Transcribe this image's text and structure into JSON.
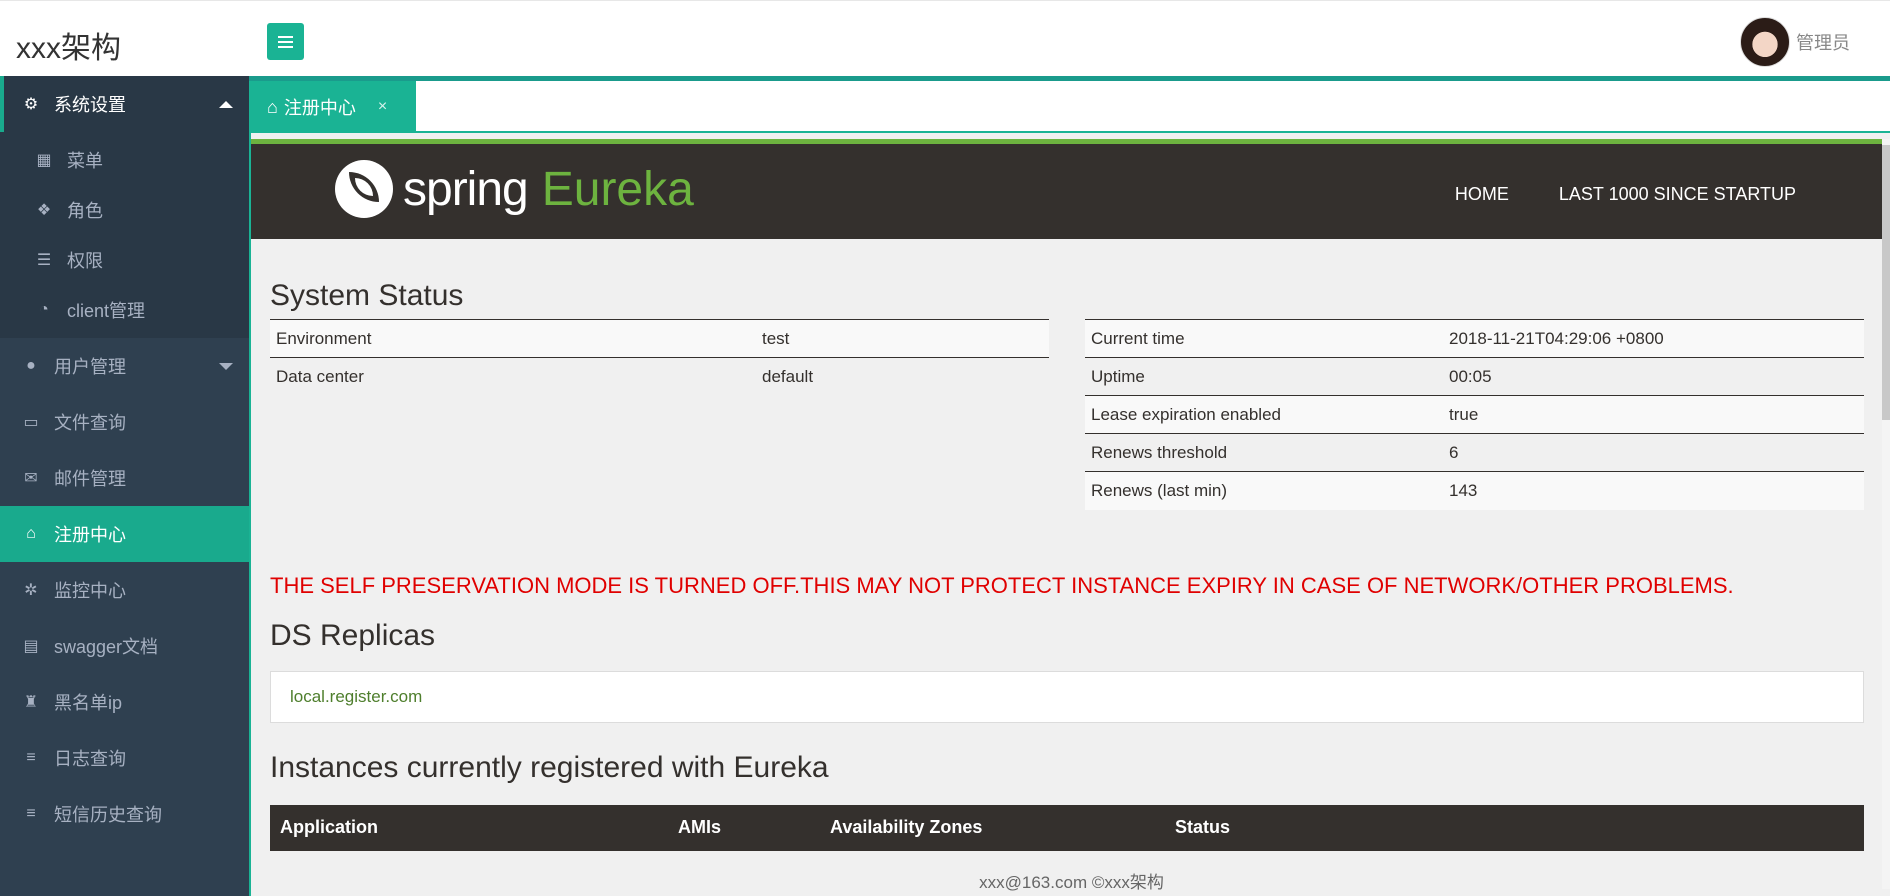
{
  "app": {
    "brand": "xxx架构"
  },
  "user": {
    "name": "管理员"
  },
  "sidebar": {
    "items": [
      {
        "label": "系统设置",
        "icon": "gears-icon",
        "expanded": true,
        "children": [
          {
            "label": "菜单",
            "icon": "windows-icon"
          },
          {
            "label": "角色",
            "icon": "cubes-icon"
          },
          {
            "label": "权限",
            "icon": "list-icon"
          },
          {
            "label": "client管理",
            "icon": "dashboard-icon"
          }
        ]
      },
      {
        "label": "用户管理",
        "icon": "user-icon",
        "expanded": false
      },
      {
        "label": "文件查询",
        "icon": "folder-open-icon"
      },
      {
        "label": "邮件管理",
        "icon": "envelope-icon"
      },
      {
        "label": "注册中心",
        "icon": "bank-icon",
        "active": true
      },
      {
        "label": "监控中心",
        "icon": "spinner-icon"
      },
      {
        "label": "swagger文档",
        "icon": "file-pdf-icon"
      },
      {
        "label": "黑名单ip",
        "icon": "user-secret-icon"
      },
      {
        "label": "日志查询",
        "icon": "bars-icon"
      },
      {
        "label": "短信历史查询",
        "icon": "bars-icon"
      }
    ]
  },
  "tabs": [
    {
      "label": "注册中心",
      "icon": "bank-icon",
      "close": "×"
    }
  ],
  "eureka": {
    "logo": {
      "spring": "spring",
      "eureka": "Eureka"
    },
    "nav": {
      "home": "HOME",
      "last1000": "LAST 1000 SINCE STARTUP"
    },
    "system_status": {
      "title": "System Status",
      "left": [
        {
          "key": "Environment",
          "value": "test"
        },
        {
          "key": "Data center",
          "value": "default"
        }
      ],
      "right": [
        {
          "key": "Current time",
          "value": "2018-11-21T04:29:06 +0800"
        },
        {
          "key": "Uptime",
          "value": "00:05"
        },
        {
          "key": "Lease expiration enabled",
          "value": "true"
        },
        {
          "key": "Renews threshold",
          "value": "6"
        },
        {
          "key": "Renews (last min)",
          "value": "143"
        }
      ]
    },
    "warning": "THE SELF PRESERVATION MODE IS TURNED OFF.THIS MAY NOT PROTECT INSTANCE EXPIRY IN CASE OF NETWORK/OTHER PROBLEMS.",
    "ds_replicas": {
      "title": "DS Replicas",
      "items": [
        "local.register.com"
      ]
    },
    "instances": {
      "title": "Instances currently registered with Eureka",
      "columns": [
        "Application",
        "AMIs",
        "Availability Zones",
        "Status"
      ]
    }
  },
  "footer": {
    "text": "xxx@163.com ©xxx架构"
  },
  "colors": {
    "accent": "#1ab394",
    "sidebar": "#2f4050",
    "eureka_dark": "#34302d",
    "eureka_green": "#6db33f",
    "warning": "#e00000"
  }
}
